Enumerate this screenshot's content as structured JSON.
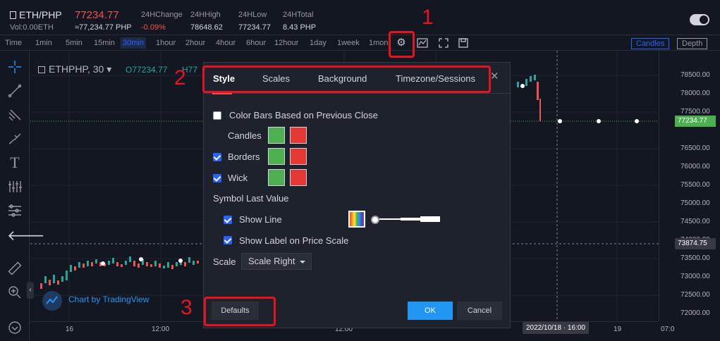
{
  "header": {
    "pair": "ETH/PHP",
    "price": "77234.77",
    "volume": "Vol:0.00ETH",
    "fiat_price": "≈77,234.77 PHP",
    "stats": [
      {
        "label": "24HChange",
        "value": "-0.09%"
      },
      {
        "label": "24HHigh",
        "value": "78648.62"
      },
      {
        "label": "24HLow",
        "value": "77234.77"
      },
      {
        "label": "24HTotal",
        "value": "8.43 PHP"
      }
    ]
  },
  "toolbar": {
    "time_label": "Time",
    "intervals": [
      "1min",
      "5min",
      "15min",
      "30min",
      "1hour",
      "2hour",
      "4hour",
      "6hour",
      "12hour",
      "1day",
      "1week",
      "1mon"
    ],
    "active_interval": "30min",
    "candles_label": "Candles",
    "depth_label": "Depth"
  },
  "chart": {
    "symbol": "ETHPHP, 30",
    "open_value": "O77234.77",
    "high_prefix": "H77",
    "price_labels": [
      "78500.00",
      "78000.00",
      "77500.00",
      "77000.00",
      "76500.00",
      "76000.00",
      "75500.00",
      "75000.00",
      "74500.00",
      "74000.00",
      "73500.00",
      "73000.00",
      "72500.00",
      "72000.00"
    ],
    "last_price": "77234.77",
    "crosshair_price": "73874.75",
    "x_labels": [
      "16",
      "12:00",
      "12:00",
      "19",
      "07:0"
    ],
    "crosshair_time": "2022/10/18 · 16:00",
    "attribution": "Chart by TradingView",
    "colors": {
      "up": "#26a69a",
      "down": "#ef5350",
      "last": "#4caf50"
    }
  },
  "dialog": {
    "tabs": [
      "Style",
      "Scales",
      "Background",
      "Timezone/Sessions"
    ],
    "active_tab": "Style",
    "color_bars_label": "Color Bars Based on Previous Close",
    "candles_label": "Candles",
    "borders_label": "Borders",
    "wick_label": "Wick",
    "symbol_last_value_label": "Symbol Last Value",
    "show_line_label": "Show Line",
    "show_label_label": "Show Label on Price Scale",
    "scale_label": "Scale",
    "scale_value": "Scale Right",
    "defaults_label": "Defaults",
    "ok_label": "OK",
    "cancel_label": "Cancel",
    "colors": {
      "green": "#4caf50",
      "red": "#e53935",
      "ok": "#2196f3"
    }
  },
  "annotations": {
    "one": "1",
    "two": "2",
    "three": "3",
    "color": "#e8131f"
  }
}
